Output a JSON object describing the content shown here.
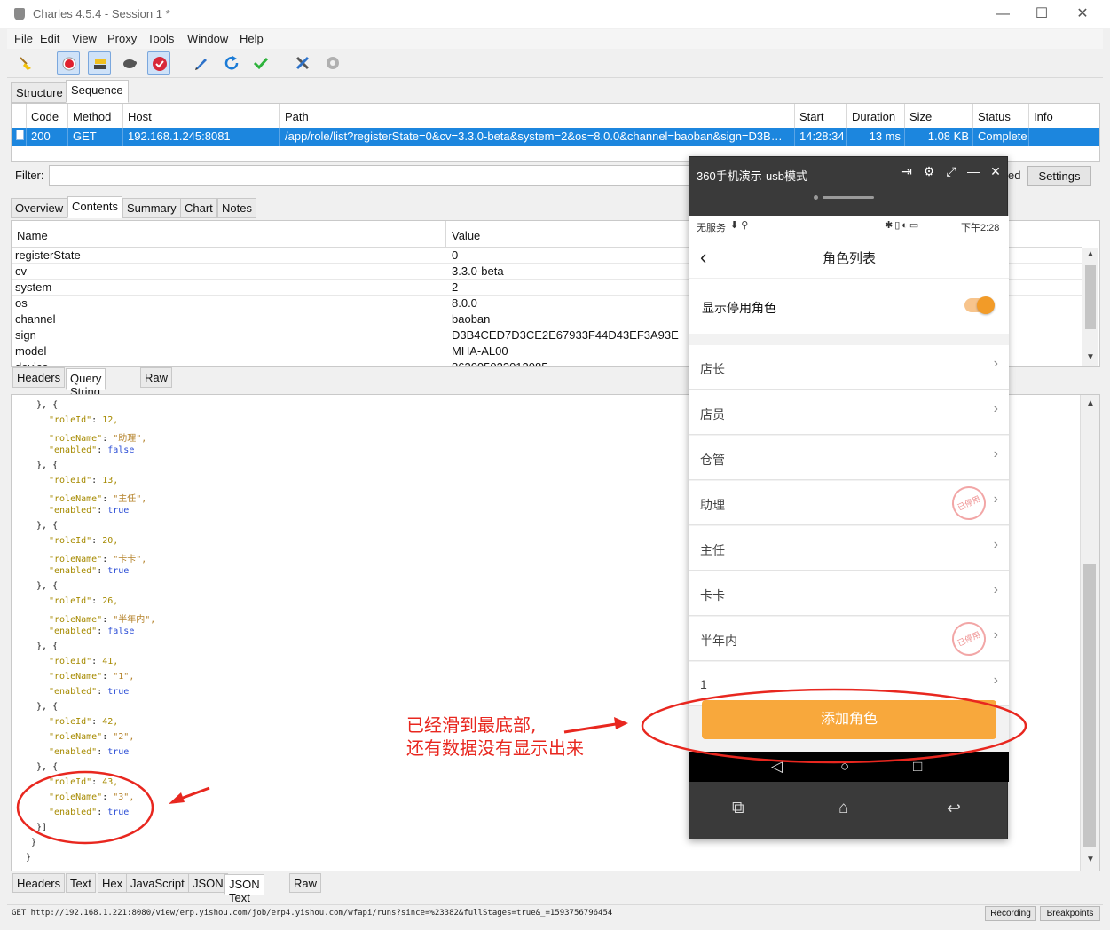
{
  "window": {
    "title": "Charles 4.5.4 - Session 1 *",
    "minimize": "—",
    "maximize": "☐",
    "close": "✕"
  },
  "menu": [
    "File",
    "Edit",
    "View",
    "Proxy",
    "Tools",
    "Window",
    "Help"
  ],
  "toolbar_icons": [
    "broom-icon",
    "record-icon",
    "throttle-icon",
    "turtle-icon",
    "breakpoint-icon",
    "pen-icon",
    "refresh-icon",
    "check-icon",
    "tools-icon",
    "gear-icon"
  ],
  "view_tabs": [
    "Structure",
    "Sequence"
  ],
  "table": {
    "headers": [
      "Code",
      "Method",
      "Host",
      "Path",
      "Start",
      "Duration",
      "Size",
      "Status",
      "Info"
    ],
    "row": {
      "code": "200",
      "method": "GET",
      "host": "192.168.1.245:8081",
      "path": "/app/role/list?registerState=0&cv=3.3.0-beta&system=2&os=8.0.0&channel=baoban&sign=D3B…",
      "start": "14:28:34",
      "duration": "13 ms",
      "size": "1.08 KB",
      "status": "Complete",
      "info": ""
    }
  },
  "filter": {
    "label": "Filter:",
    "settings": "Settings",
    "partial": "ed"
  },
  "detail_tabs": [
    "Overview",
    "Contents",
    "Summary",
    "Chart",
    "Notes"
  ],
  "params": {
    "headers": [
      "Name",
      "Value"
    ],
    "rows": [
      {
        "name": "registerState",
        "value": "0"
      },
      {
        "name": "cv",
        "value": "3.3.0-beta"
      },
      {
        "name": "system",
        "value": "2"
      },
      {
        "name": "os",
        "value": "8.0.0"
      },
      {
        "name": "channel",
        "value": "baoban"
      },
      {
        "name": "sign",
        "value": "D3B4CED7D3CE2E67933F44D43EF3A93E"
      },
      {
        "name": "model",
        "value": "MHA-AL00"
      },
      {
        "name": "device",
        "value": "863005033013085"
      }
    ]
  },
  "request_tabs": [
    "Headers",
    "Query String",
    "Raw"
  ],
  "json_lines": [
    {
      "t": "  }, {",
      "k": "",
      "v": "",
      "vt": ""
    },
    {
      "t": "",
      "k": "\"roleId\"",
      "v": "12,",
      "vt": "n"
    },
    {
      "t": "",
      "k": "\"roleName\"",
      "v": "\"助理\",",
      "vt": "s"
    },
    {
      "t": "",
      "k": "\"enabled\"",
      "v": "false",
      "vt": "b"
    },
    {
      "t": "  }, {",
      "k": "",
      "v": "",
      "vt": ""
    },
    {
      "t": "",
      "k": "\"roleId\"",
      "v": "13,",
      "vt": "n"
    },
    {
      "t": "",
      "k": "\"roleName\"",
      "v": "\"主任\",",
      "vt": "s"
    },
    {
      "t": "",
      "k": "\"enabled\"",
      "v": "true",
      "vt": "b"
    },
    {
      "t": "  }, {",
      "k": "",
      "v": "",
      "vt": ""
    },
    {
      "t": "",
      "k": "\"roleId\"",
      "v": "20,",
      "vt": "n"
    },
    {
      "t": "",
      "k": "\"roleName\"",
      "v": "\"卡卡\",",
      "vt": "s"
    },
    {
      "t": "",
      "k": "\"enabled\"",
      "v": "true",
      "vt": "b"
    },
    {
      "t": "  }, {",
      "k": "",
      "v": "",
      "vt": ""
    },
    {
      "t": "",
      "k": "\"roleId\"",
      "v": "26,",
      "vt": "n"
    },
    {
      "t": "",
      "k": "\"roleName\"",
      "v": "\"半年内\",",
      "vt": "s"
    },
    {
      "t": "",
      "k": "\"enabled\"",
      "v": "false",
      "vt": "b"
    },
    {
      "t": "  }, {",
      "k": "",
      "v": "",
      "vt": ""
    },
    {
      "t": "",
      "k": "\"roleId\"",
      "v": "41,",
      "vt": "n"
    },
    {
      "t": "",
      "k": "\"roleName\"",
      "v": "\"1\",",
      "vt": "s"
    },
    {
      "t": "",
      "k": "\"enabled\"",
      "v": "true",
      "vt": "b"
    },
    {
      "t": "  }, {",
      "k": "",
      "v": "",
      "vt": ""
    },
    {
      "t": "",
      "k": "\"roleId\"",
      "v": "42,",
      "vt": "n"
    },
    {
      "t": "",
      "k": "\"roleName\"",
      "v": "\"2\",",
      "vt": "s"
    },
    {
      "t": "",
      "k": "\"enabled\"",
      "v": "true",
      "vt": "b"
    },
    {
      "t": "  }, {",
      "k": "",
      "v": "",
      "vt": ""
    },
    {
      "t": "",
      "k": "\"roleId\"",
      "v": "43,",
      "vt": "n"
    },
    {
      "t": "",
      "k": "\"roleName\"",
      "v": "\"3\",",
      "vt": "s"
    },
    {
      "t": "",
      "k": "\"enabled\"",
      "v": "true",
      "vt": "b"
    },
    {
      "t": "  }]",
      "k": "",
      "v": "",
      "vt": ""
    },
    {
      "t": " }",
      "k": "",
      "v": "",
      "vt": ""
    },
    {
      "t": "}",
      "k": "",
      "v": "",
      "vt": ""
    }
  ],
  "response_tabs": [
    "Headers",
    "Text",
    "Hex",
    "JavaScript",
    "JSON",
    "JSON Text",
    "Raw"
  ],
  "status": {
    "url": "GET http://192.168.1.221:8080/view/erp.yishou.com/job/erp4.yishou.com/wfapi/runs?since=%23382&fullStages=true&_=1593756796454",
    "recording": "Recording",
    "breakpoints": "Breakpoints"
  },
  "phone": {
    "window_title": "360手机演示-usb模式",
    "status_left": "无服务",
    "status_time": "下午2:28",
    "nav_title": "角色列表",
    "toggle_label": "显示停用角色",
    "toggle_on": true,
    "stamp": "已停用",
    "roles": [
      {
        "name": "店长",
        "disabled": false
      },
      {
        "name": "店员",
        "disabled": false
      },
      {
        "name": "仓管",
        "disabled": false
      },
      {
        "name": "助理",
        "disabled": true
      },
      {
        "name": "主任",
        "disabled": false
      },
      {
        "name": "卡卡",
        "disabled": false
      },
      {
        "name": "半年内",
        "disabled": true
      },
      {
        "name": "1",
        "disabled": false
      }
    ],
    "add_button": "添加角色"
  },
  "annotation": {
    "line1": "已经滑到最底部,",
    "line2": "还有数据没有显示出来"
  },
  "colors": {
    "selection": "#1c86de",
    "accent": "#f8a83c",
    "annotation": "#e8271f"
  }
}
